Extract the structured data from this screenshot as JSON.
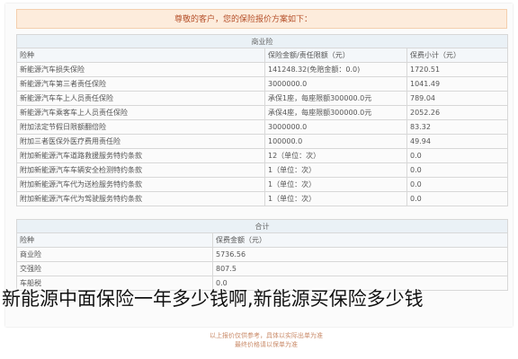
{
  "notice": "尊敬的客户，您的保险报价方案如下：",
  "main_table": {
    "section_title": "商业险",
    "headers": [
      "险种",
      "保险金额/责任限额（元）",
      "保费小计（元）"
    ],
    "rows": [
      [
        "新能源汽车损失保险",
        "141248.32(免赔金额：0.0)",
        "1720.51"
      ],
      [
        "新能源汽车第三者责任保险",
        "3000000.0",
        "1041.49"
      ],
      [
        "新能源汽车车上人员责任保险",
        "承保1座，每座限额300000.0元",
        "789.04"
      ],
      [
        "新能源汽车乘客车上人员责任保险",
        "承保4座，每座限额300000.0元",
        "2052.26"
      ],
      [
        "附加法定节假日限额翻倍险",
        "3000000.0",
        "83.32"
      ],
      [
        "附加三者医保外医疗费用责任险",
        "100000.0",
        "49.94"
      ],
      [
        "附加新能源汽车道路救援服务特约条款",
        "12（单位：次）",
        "0.0"
      ],
      [
        "附加新能源汽车车辆安全检测特约条款",
        "1（单位：次）",
        "0.0"
      ],
      [
        "附加新能源汽车代为送检服务特约条款",
        "1（单位：次）",
        "0.0"
      ],
      [
        "附加新能源汽车代为驾驶服务特约条款",
        "1（单位：次）",
        "0.0"
      ]
    ]
  },
  "summary_table": {
    "section_title": "合计",
    "headers": [
      "险种",
      "保费金额（元）"
    ],
    "rows": [
      [
        "商业险",
        "5736.56"
      ],
      [
        "交强险",
        "807.5"
      ],
      [
        "车船税",
        "0.0"
      ]
    ]
  },
  "caption": "新能源中面保险一年多少钱啊,新能源买保险多少钱",
  "faded_footer": [
    "以上报价仅供参考，具体以实际出单为准",
    "最终价格请以保单为准"
  ]
}
